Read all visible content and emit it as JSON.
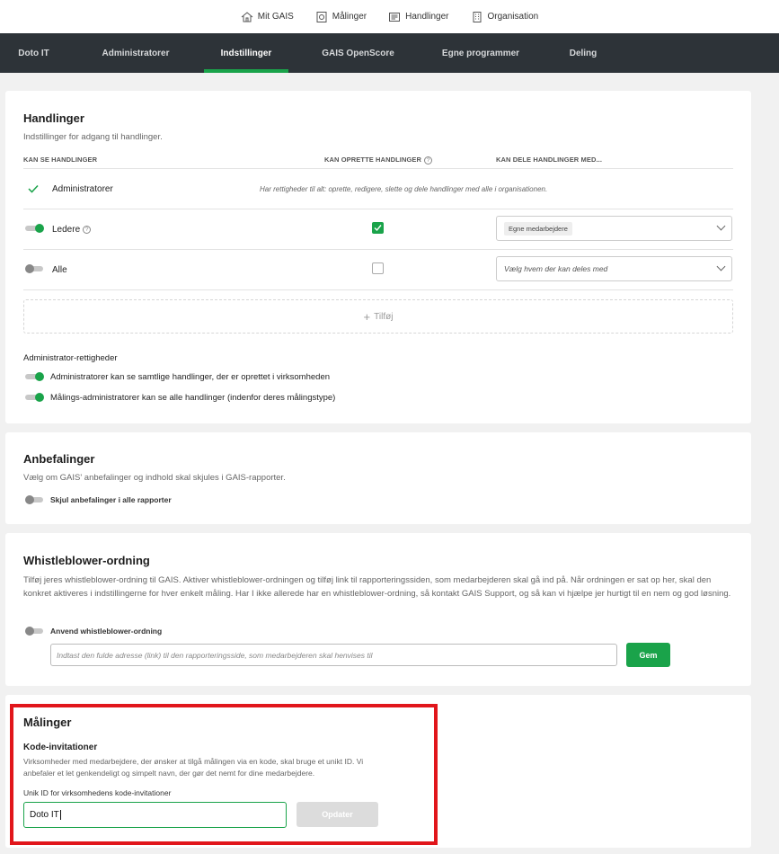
{
  "topnav": {
    "items": [
      {
        "label": "Mit GAIS",
        "icon": "home-icon"
      },
      {
        "label": "Målinger",
        "icon": "survey-icon"
      },
      {
        "label": "Handlinger",
        "icon": "actions-icon"
      },
      {
        "label": "Organisation",
        "icon": "building-icon"
      }
    ]
  },
  "tabs": [
    {
      "label": "Doto IT"
    },
    {
      "label": "Administratorer"
    },
    {
      "label": "Indstillinger",
      "active": true
    },
    {
      "label": "GAIS OpenScore"
    },
    {
      "label": "Egne programmer"
    },
    {
      "label": "Deling"
    }
  ],
  "handlinger": {
    "title": "Handlinger",
    "subtitle": "Indstillinger for adgang til handlinger.",
    "col1": "KAN SE HANDLINGER",
    "col2": "KAN OPRETTE HANDLINGER",
    "col3": "KAN DELE HANDLINGER MED...",
    "rows": [
      {
        "label": "Administratorer",
        "note": "Har rettigheder til alt: oprette, redigere, slette og dele handlinger med alle i organisationen."
      },
      {
        "label": "Ledere",
        "select_chip": "Egne medarbejdere"
      },
      {
        "label": "Alle",
        "select_placeholder": "Vælg hvem der kan deles med"
      }
    ],
    "add_label": "Tilføj",
    "admin_title": "Administrator-rettigheder",
    "admin_opt1": "Administratorer kan se samtlige handlinger, der er oprettet i virksomheden",
    "admin_opt2": "Målings-administratorer kan se alle handlinger (indenfor deres målingstype)"
  },
  "anbefalinger": {
    "title": "Anbefalinger",
    "subtitle": "Vælg om GAIS' anbefalinger og indhold skal skjules i GAIS-rapporter.",
    "toggle_label": "Skjul anbefalinger i alle rapporter"
  },
  "whistleblower": {
    "title": "Whistleblower-ordning",
    "text": "Tilføj jeres whistleblower-ordning til GAIS. Aktiver whistleblower-ordningen og tilføj link til rapporteringssiden, som medarbejderen skal gå ind på. Når ordningen er sat op her, skal den konkret aktiveres i indstillingerne for hver enkelt måling. Har I ikke allerede har en whistleblower-ordning, så kontakt GAIS Support, og så kan vi hjælpe jer hurtigt til en nem og god løsning.",
    "toggle_label": "Anvend whistleblower-ordning",
    "input_placeholder": "Indtast den fulde adresse (link) til den rapporteringsside, som medarbejderen skal henvises til",
    "save_label": "Gem"
  },
  "malinger": {
    "title": "Målinger",
    "subtitle": "Kode-invitationer",
    "text": "Virksomheder med medarbejdere, der ønsker at tilgå målingen via en kode, skal bruge et unikt ID. Vi anbefaler et let genkendeligt og simpelt navn, der gør det nemt for dine medarbejdere.",
    "field_label": "Unik ID for virksomhedens kode-invitationer",
    "field_value": "Doto IT",
    "update_label": "Opdater"
  },
  "colors": {
    "accent": "#1aa34a",
    "tabbar": "#2d3338",
    "highlight": "#e1161b"
  }
}
